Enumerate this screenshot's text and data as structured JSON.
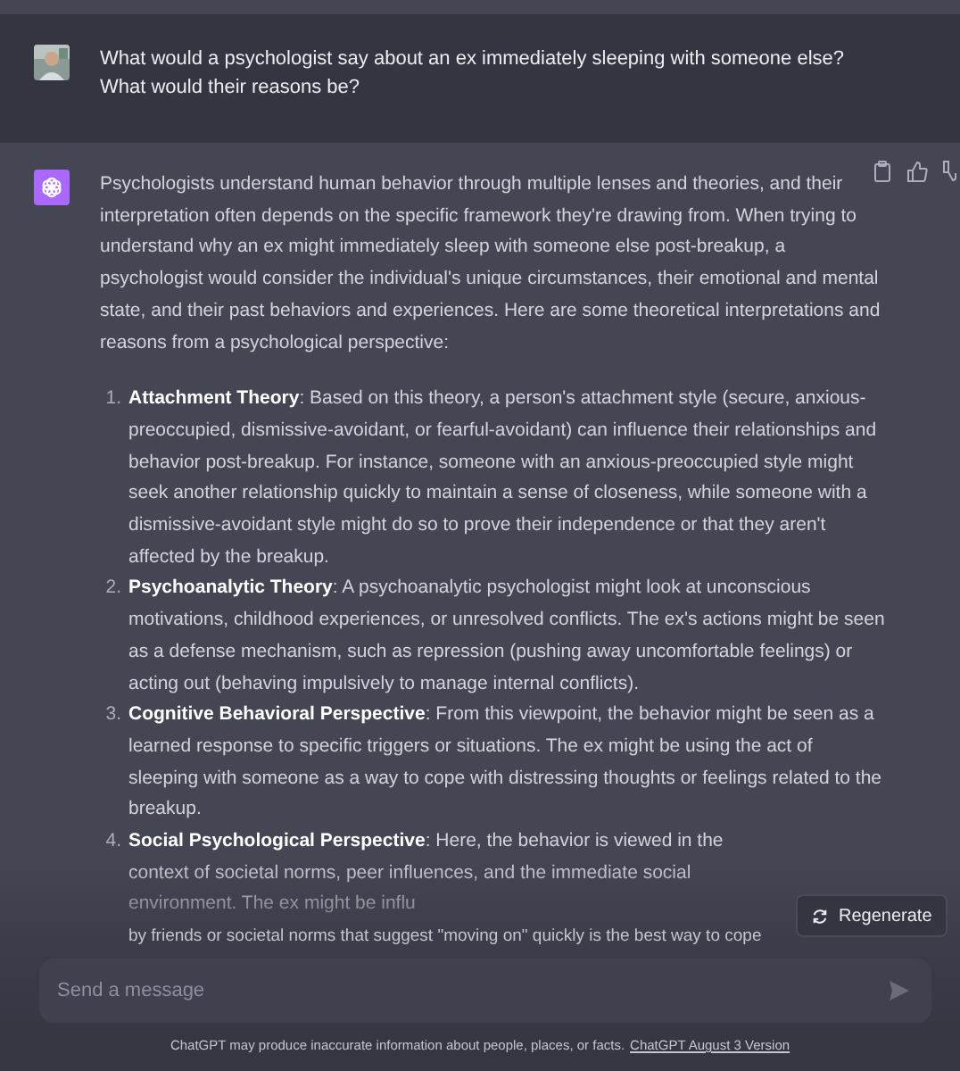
{
  "user_message": {
    "text": "What would a psychologist say about an ex immediately sleeping with someone else? What would their reasons be?"
  },
  "assistant_message": {
    "intro": "Psychologists understand human behavior through multiple lenses and theories, and their interpretation often depends on the specific framework they're drawing from. When trying to understand why an ex might immediately sleep with someone else post-breakup, a psychologist would consider the individual's unique circumstances, their emotional and mental state, and their past behaviors and experiences. Here are some theoretical interpretations and reasons from a psychological perspective:",
    "items": [
      {
        "number": "1.",
        "text": "**Attachment Theory**: Based on this theory, a person's attachment style (secure, anxious-preoccupied, dismissive-avoidant, or fearful-avoidant) can influence their relationships and behavior post-breakup. For instance, someone with an anxious-preoccupied style might seek another relationship quickly to maintain a sense of closeness, while someone with a dismissive-avoidant style might do so to prove their independence or that they aren't affected by the breakup."
      },
      {
        "number": "2.",
        "text": "**Psychoanalytic Theory**: A psychoanalytic psychologist might look at unconscious motivations, childhood experiences, or unresolved conflicts. The ex's actions might be seen as a defense mechanism, such as repression (pushing away uncomfortable feelings) or acting out (behaving impulsively to manage internal conflicts)."
      },
      {
        "number": "3.",
        "text": "**Cognitive Behavioral Perspective**: From this viewpoint, the behavior might be seen as a learned response to specific triggers or situations. The ex might be using the act of sleeping with someone as a way to cope with distressing thoughts or feelings related to the breakup."
      },
      {
        "number": "4.",
        "text": "**Social Psychological Perspective**: Here, the behavior is viewed in the context of societal norms, peer influences, and the immediate social environment. The ex might be influ",
        "continuation": "by friends or societal norms that suggest \"moving on\" quickly is the best way to cope"
      }
    ]
  },
  "regenerate_button": {
    "label": "Regenerate"
  },
  "composer": {
    "placeholder": "Send a message"
  },
  "footer": {
    "text": "ChatGPT may produce inaccurate information about people, places, or facts.",
    "link": "ChatGPT August 3 Version"
  }
}
